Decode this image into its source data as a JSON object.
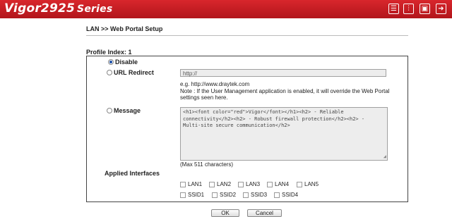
{
  "header": {
    "brand": "Vigor2925",
    "series": "Series",
    "color": "#c61d23"
  },
  "header_icons": [
    {
      "name": "menu-icon"
    },
    {
      "name": "settings-sliders-icon"
    },
    {
      "name": "save-icon"
    },
    {
      "name": "logout-icon"
    }
  ],
  "breadcrumb": "LAN >> Web Portal Setup",
  "profile_label": "Profile Index: 1",
  "options": {
    "disable": {
      "label": "Disable",
      "selected": true
    },
    "url_redirect": {
      "label": "URL Redirect",
      "selected": false,
      "value": "http://"
    },
    "message": {
      "label": "Message",
      "selected": false
    }
  },
  "example_text": "e.g. http://www.draytek.com",
  "note_text": "Note : If the User Management application is enabled, it will override the Web Portal settings seen here.",
  "message_text": "<h1><font color=\"red\">Vigor</font></h1><h2> - Reliable connectivity</h2><h2> - Robust firewall protection</h2><h2> - Multi-site secure communication</h2>",
  "max_chars": "(Max 511 characters)",
  "applied_label": "Applied Interfaces",
  "interfaces": {
    "lan": [
      "LAN1",
      "LAN2",
      "LAN3",
      "LAN4",
      "LAN5"
    ],
    "ssid": [
      "SSID1",
      "SSID2",
      "SSID3",
      "SSID4"
    ]
  },
  "buttons": {
    "ok": "OK",
    "cancel": "Cancel"
  }
}
